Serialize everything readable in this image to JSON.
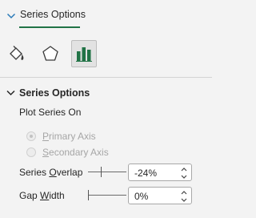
{
  "header": {
    "label": "Series Options",
    "icon": "chevron-down-icon"
  },
  "categories": [
    {
      "name": "fill-line",
      "icon": "paint-bucket-icon",
      "selected": false
    },
    {
      "name": "effects",
      "icon": "pentagon-icon",
      "selected": false
    },
    {
      "name": "series-options",
      "icon": "bar-chart-icon",
      "selected": true
    }
  ],
  "section": {
    "title": "Series Options",
    "plot_series_on_label": "Plot Series On",
    "radios": [
      {
        "before": "",
        "mnemonic": "P",
        "after": "rimary Axis",
        "checked": true,
        "enabled": false
      },
      {
        "before": "",
        "mnemonic": "S",
        "after": "econdary Axis",
        "checked": false,
        "enabled": false
      }
    ],
    "overlap": {
      "label_before": "Series ",
      "label_mnemonic": "O",
      "label_after": "verlap",
      "value": "-24%",
      "slider_level_percent": -24
    },
    "gap": {
      "label_before": "Gap ",
      "label_mnemonic": "W",
      "label_after": "idth",
      "value": "0%",
      "slider_level_percent": 0
    }
  },
  "colors": {
    "accent": "#217346",
    "icon_green": "#217346",
    "panel_bg": "#f3f3f3"
  }
}
